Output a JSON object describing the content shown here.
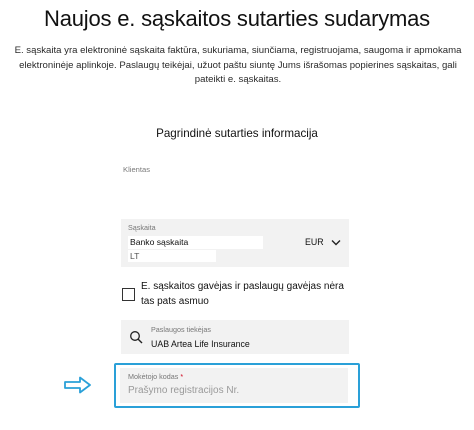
{
  "page": {
    "title": "Naujos e. sąskaitos sutarties sudarymas",
    "intro": "E. sąskaita yra elektroninė sąskaita faktūra, sukuriama, siunčiama, registruojama, saugoma ir apmokama elektroninėje aplinkoje. Paslaugų teikėjai, užuot paštu siuntę Jums išrašomas popierines sąskaitas, gali pateikti e. sąskaitas.",
    "section_title": "Pagrindinė sutarties informacija",
    "client_label": "Klientas"
  },
  "account": {
    "label": "Sąskaita",
    "type": "Banko sąskaita",
    "currency": "EUR",
    "iban_prefix": "LT",
    "chevron_icon": "chevron-down-icon"
  },
  "same_payer": {
    "label": "E. sąskaitos gavėjas ir paslaugų gavėjas nėra tas pats asmuo",
    "checked": false
  },
  "provider": {
    "label": "Paslaugos tiekėjas",
    "value": "UAB Artea Life Insurance",
    "icon": "search-icon"
  },
  "payment_code": {
    "label": "Mokėtojo kodas",
    "required_mark": "*",
    "placeholder": "Prašymo registracijos Nr."
  },
  "annotation": {
    "arrow_icon": "arrow-right-icon",
    "highlight_color": "#2aa0d8"
  }
}
